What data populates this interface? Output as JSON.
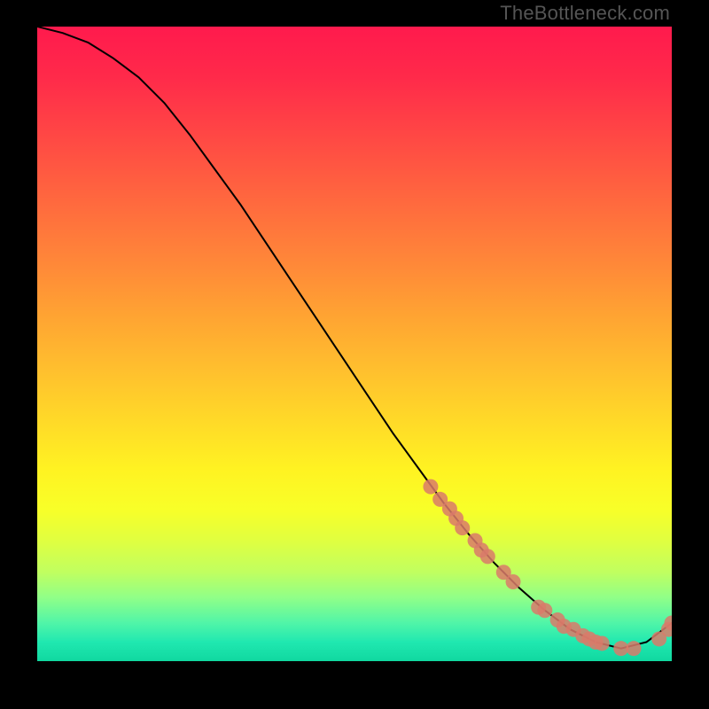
{
  "watermark": "TheBottleneck.com",
  "chart_data": {
    "type": "line",
    "title": "",
    "xlabel": "",
    "ylabel": "",
    "xlim": [
      0,
      100
    ],
    "ylim": [
      0,
      100
    ],
    "grid": false,
    "legend": false,
    "series": [
      {
        "name": "curve",
        "color": "#000000",
        "x": [
          0,
          4,
          8,
          12,
          16,
          20,
          24,
          28,
          32,
          36,
          40,
          44,
          48,
          52,
          56,
          60,
          64,
          68,
          72,
          76,
          80,
          84,
          88,
          92,
          96,
          100
        ],
        "y": [
          100,
          99,
          97.5,
          95,
          92,
          88,
          83,
          77.5,
          72,
          66,
          60,
          54,
          48,
          42,
          36,
          30.5,
          25,
          20,
          15.5,
          11.5,
          8,
          5,
          3,
          2,
          3,
          6
        ]
      },
      {
        "name": "markers",
        "color": "#d97a6a",
        "type": "scatter",
        "x": [
          62,
          63.5,
          65,
          66,
          67,
          69,
          70,
          71,
          73.5,
          75,
          79,
          80,
          82,
          83,
          84.5,
          86,
          87,
          88,
          89,
          92,
          94,
          98,
          99.5,
          100
        ],
        "y": [
          27.5,
          25.5,
          24,
          22.5,
          21,
          19,
          17.5,
          16.5,
          14,
          12.5,
          8.5,
          8,
          6.5,
          5.5,
          5,
          4,
          3.5,
          3,
          2.8,
          2,
          2,
          3.5,
          5,
          6
        ]
      }
    ]
  }
}
